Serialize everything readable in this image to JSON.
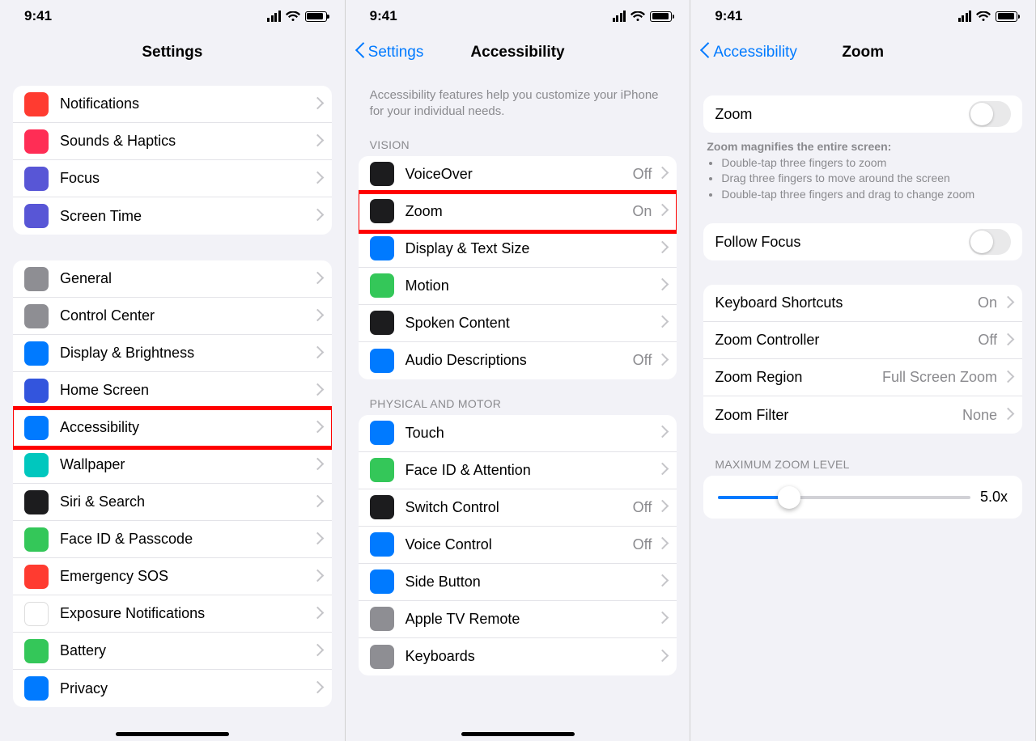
{
  "status": {
    "time": "9:41"
  },
  "panel1": {
    "title": "Settings",
    "group1": [
      {
        "label": "Notifications",
        "iconColor": "#ff3b30",
        "name": "notifications"
      },
      {
        "label": "Sounds & Haptics",
        "iconColor": "#ff2d55",
        "name": "sounds-haptics"
      },
      {
        "label": "Focus",
        "iconColor": "#5856d6",
        "name": "focus"
      },
      {
        "label": "Screen Time",
        "iconColor": "#5856d6",
        "name": "screen-time"
      }
    ],
    "group2": [
      {
        "label": "General",
        "iconColor": "#8e8e93",
        "name": "general"
      },
      {
        "label": "Control Center",
        "iconColor": "#8e8e93",
        "name": "control-center"
      },
      {
        "label": "Display & Brightness",
        "iconColor": "#007aff",
        "name": "display-brightness"
      },
      {
        "label": "Home Screen",
        "iconColor": "#3355dd",
        "name": "home-screen"
      },
      {
        "label": "Accessibility",
        "iconColor": "#007aff",
        "name": "accessibility",
        "highlighted": true
      },
      {
        "label": "Wallpaper",
        "iconColor": "#00c7be",
        "name": "wallpaper"
      },
      {
        "label": "Siri & Search",
        "iconColor": "#1c1c1e",
        "name": "siri-search"
      },
      {
        "label": "Face ID & Passcode",
        "iconColor": "#34c759",
        "name": "faceid-passcode"
      },
      {
        "label": "Emergency SOS",
        "iconColor": "#ff3b30",
        "name": "emergency-sos"
      },
      {
        "label": "Exposure Notifications",
        "iconColor": "#ffffff",
        "name": "exposure-notifications"
      },
      {
        "label": "Battery",
        "iconColor": "#34c759",
        "name": "battery"
      },
      {
        "label": "Privacy",
        "iconColor": "#007aff",
        "name": "privacy"
      }
    ]
  },
  "panel2": {
    "back": "Settings",
    "title": "Accessibility",
    "intro": "Accessibility features help you customize your iPhone for your individual needs.",
    "visionHeader": "VISION",
    "vision": [
      {
        "label": "VoiceOver",
        "value": "Off",
        "iconColor": "#1c1c1e",
        "name": "voiceover"
      },
      {
        "label": "Zoom",
        "value": "On",
        "iconColor": "#1c1c1e",
        "name": "zoom",
        "highlighted": true
      },
      {
        "label": "Display & Text Size",
        "value": "",
        "iconColor": "#007aff",
        "name": "display-text-size"
      },
      {
        "label": "Motion",
        "value": "",
        "iconColor": "#34c759",
        "name": "motion"
      },
      {
        "label": "Spoken Content",
        "value": "",
        "iconColor": "#1c1c1e",
        "name": "spoken-content"
      },
      {
        "label": "Audio Descriptions",
        "value": "Off",
        "iconColor": "#007aff",
        "name": "audio-descriptions"
      }
    ],
    "physicalHeader": "PHYSICAL AND MOTOR",
    "physical": [
      {
        "label": "Touch",
        "iconColor": "#007aff",
        "name": "touch"
      },
      {
        "label": "Face ID & Attention",
        "iconColor": "#34c759",
        "name": "faceid-attention"
      },
      {
        "label": "Switch Control",
        "value": "Off",
        "iconColor": "#1c1c1e",
        "name": "switch-control"
      },
      {
        "label": "Voice Control",
        "value": "Off",
        "iconColor": "#007aff",
        "name": "voice-control"
      },
      {
        "label": "Side Button",
        "iconColor": "#007aff",
        "name": "side-button"
      },
      {
        "label": "Apple TV Remote",
        "iconColor": "#8e8e93",
        "name": "apple-tv-remote"
      },
      {
        "label": "Keyboards",
        "iconColor": "#8e8e93",
        "name": "keyboards"
      }
    ]
  },
  "panel3": {
    "back": "Accessibility",
    "title": "Zoom",
    "zoomToggle": {
      "label": "Zoom",
      "on": false,
      "highlighted": true
    },
    "zoomDescTitle": "Zoom magnifies the entire screen:",
    "zoomDescItems": [
      "Double-tap three fingers to zoom",
      "Drag three fingers to move around the screen",
      "Double-tap three fingers and drag to change zoom"
    ],
    "followFocus": {
      "label": "Follow Focus",
      "on": false
    },
    "options": [
      {
        "label": "Keyboard Shortcuts",
        "value": "On",
        "name": "keyboard-shortcuts"
      },
      {
        "label": "Zoom Controller",
        "value": "Off",
        "name": "zoom-controller"
      },
      {
        "label": "Zoom Region",
        "value": "Full Screen Zoom",
        "name": "zoom-region"
      },
      {
        "label": "Zoom Filter",
        "value": "None",
        "name": "zoom-filter"
      }
    ],
    "maxHeader": "MAXIMUM ZOOM LEVEL",
    "maxValue": "5.0x"
  }
}
